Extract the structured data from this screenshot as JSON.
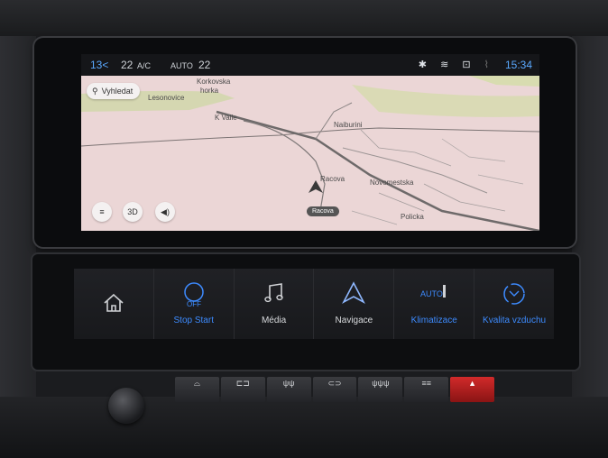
{
  "status_bar": {
    "temp_left": "13<",
    "fan": "22",
    "ac": "A/C",
    "auto": "AUTO",
    "temp_right": "22",
    "time": "15:34",
    "icons": [
      "bluetooth-icon",
      "wifi-icon",
      "car-icon",
      "signal-icon"
    ]
  },
  "map": {
    "search_label": "Vyhledat",
    "labels": [
      "Korkovska",
      "horka",
      "Lesonovice",
      "K Valle",
      "Naiburini",
      "Racova",
      "Novomestska",
      "Policka"
    ],
    "street_chip": "Racova",
    "buttons": {
      "menu": "≡",
      "view3d": "3D",
      "sound": "◀)"
    }
  },
  "tiles": [
    {
      "label": "",
      "icon": "home-icon"
    },
    {
      "label": "Stop Start",
      "icon": "stop-start-off-icon",
      "sub": "OFF"
    },
    {
      "label": "Média",
      "icon": "music-note-icon"
    },
    {
      "label": "Navigace",
      "icon": "navigation-arrow-icon"
    },
    {
      "label": "Klimatizace",
      "icon": "climate-auto-icon",
      "sub": "AUTO"
    },
    {
      "label": "Kvalita vzduchu",
      "icon": "air-quality-icon"
    }
  ],
  "physical_buttons": [
    "⌓",
    "⊏⊐",
    "ψψ",
    "⊂⊃",
    "ψψψ",
    "≡≡",
    "▲"
  ],
  "colors": {
    "accent": "#3d8bff",
    "hazard": "#d12a2a"
  }
}
